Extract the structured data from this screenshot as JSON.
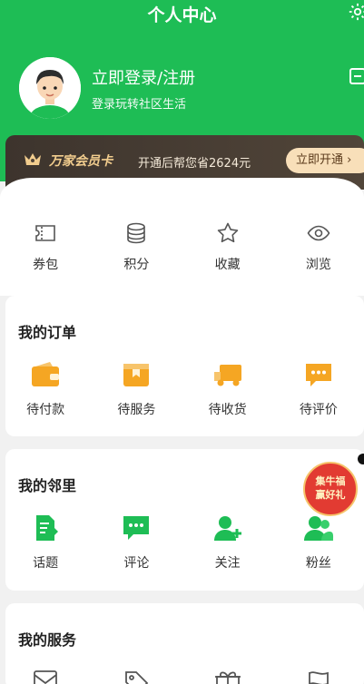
{
  "header": {
    "title": "个人中心",
    "settings_icon": "gear-icon",
    "scan_icon": "scan-icon"
  },
  "user": {
    "login_label": "立即登录/注册",
    "subtitle": "登录玩转社区生活"
  },
  "vip": {
    "name": "万家会员卡",
    "description": "开通后帮您省2624元",
    "button": "立即开通 ›"
  },
  "quick_links": [
    {
      "label": "券包",
      "icon": "coupon-icon"
    },
    {
      "label": "积分",
      "icon": "points-icon"
    },
    {
      "label": "收藏",
      "icon": "star-icon"
    },
    {
      "label": "浏览",
      "icon": "eye-icon"
    }
  ],
  "orders": {
    "title": "我的订单",
    "items": [
      {
        "label": "待付款",
        "icon": "wallet-icon"
      },
      {
        "label": "待服务",
        "icon": "service-icon"
      },
      {
        "label": "待收货",
        "icon": "truck-icon"
      },
      {
        "label": "待评价",
        "icon": "comment-icon"
      }
    ]
  },
  "neighbors": {
    "title": "我的邻里",
    "items": [
      {
        "label": "话题",
        "icon": "topic-icon"
      },
      {
        "label": "评论",
        "icon": "chat-icon"
      },
      {
        "label": "关注",
        "icon": "follow-icon"
      },
      {
        "label": "粉丝",
        "icon": "fans-icon"
      }
    ]
  },
  "services": {
    "title": "我的服务"
  },
  "promo": {
    "line1": "集牛福",
    "line2": "赢好礼"
  },
  "colors": {
    "brand_green": "#1ebd55",
    "order_orange": "#f5a623",
    "vip_gold": "#f2cd8e"
  }
}
